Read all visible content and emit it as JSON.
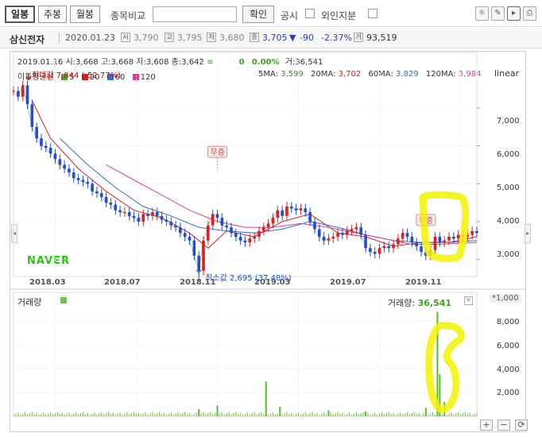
{
  "toolbar": {
    "tabs": [
      {
        "label": "일봉",
        "active": true
      },
      {
        "label": "주봉",
        "active": false
      },
      {
        "label": "월봉",
        "active": false
      }
    ],
    "compare_label": "종목비교",
    "compare_input_value": "",
    "confirm_label": "확인",
    "notice_label": "공시",
    "foreign_label": "외인지분",
    "tool_icons": [
      "lightbulb-icon",
      "pencil-icon",
      "cursor-icon",
      "print-icon"
    ]
  },
  "stock": {
    "name": "삼신전자",
    "date": "2020.01.23",
    "open_badge": "시",
    "open": "3,790",
    "high_badge": "고",
    "high": "3,795",
    "low_badge": "저",
    "low": "3,680",
    "close_badge": "종",
    "close": "3,705",
    "change_arrow": "▼",
    "change": "-90",
    "change_pct": "-2.37%",
    "volume_badge": "거",
    "volume": "93,519"
  },
  "cursor_info": {
    "date": "2019.01.16",
    "open_label": "시:",
    "open": "3,668",
    "high_label": "고:",
    "high": "3,668",
    "low_label": "저:",
    "low": "3,608",
    "close_label": "종:",
    "close": "3,642",
    "diff": "0",
    "diff_pct": "0.00%",
    "vol_label": "거:",
    "volume": "36,541"
  },
  "moving_average": {
    "title": "이동평균선",
    "periods": [
      {
        "label": "5",
        "color": "#5aa02c"
      },
      {
        "label": "20",
        "color": "#d62020"
      },
      {
        "label": "60",
        "color": "#2f6fd0"
      },
      {
        "label": "120",
        "color": "#e23c9a"
      }
    ],
    "values": [
      {
        "label": "5MA:",
        "value": "3,599",
        "color": "#3a8a1a"
      },
      {
        "label": "20MA:",
        "value": "3,702",
        "color": "#d62020"
      },
      {
        "label": "60MA:",
        "value": "3,829",
        "color": "#2f6fd0"
      },
      {
        "label": "120MA:",
        "value": "3,984",
        "color": "#e23c9a"
      }
    ]
  },
  "scale_mode": "linear",
  "chart_data": {
    "type": "line",
    "price_axis": {
      "ticks": [
        "7,000",
        "6,000",
        "5,000",
        "4,000",
        "3,000"
      ],
      "values": [
        7000,
        6000,
        5000,
        4000,
        3000
      ],
      "range": [
        2550,
        7650
      ]
    },
    "x_ticks": [
      "2018.03",
      "2018.07",
      "2018.11",
      "2019.03",
      "2019.07",
      "2019.11"
    ],
    "x_tick_pos": [
      0.09,
      0.265,
      0.44,
      0.615,
      0.79,
      0.965
    ],
    "price_series": [
      [
        0.0,
        7450
      ],
      [
        0.01,
        7300
      ],
      [
        0.02,
        7600
      ],
      [
        0.03,
        7100
      ],
      [
        0.04,
        6500
      ],
      [
        0.05,
        6200
      ],
      [
        0.06,
        6000
      ],
      [
        0.07,
        5950
      ],
      [
        0.08,
        5800
      ],
      [
        0.09,
        5650
      ],
      [
        0.1,
        5500
      ],
      [
        0.11,
        5400
      ],
      [
        0.12,
        5300
      ],
      [
        0.13,
        5150
      ],
      [
        0.14,
        5100
      ],
      [
        0.15,
        5050
      ],
      [
        0.16,
        5000
      ],
      [
        0.17,
        4800
      ],
      [
        0.18,
        4750
      ],
      [
        0.19,
        4650
      ],
      [
        0.2,
        4500
      ],
      [
        0.21,
        4450
      ],
      [
        0.22,
        4300
      ],
      [
        0.23,
        4250
      ],
      [
        0.24,
        4250
      ],
      [
        0.25,
        4150
      ],
      [
        0.26,
        4100
      ],
      [
        0.27,
        4000
      ],
      [
        0.28,
        4200
      ],
      [
        0.29,
        4150
      ],
      [
        0.3,
        4250
      ],
      [
        0.31,
        4150
      ],
      [
        0.32,
        4050
      ],
      [
        0.33,
        4000
      ],
      [
        0.34,
        3900
      ],
      [
        0.35,
        3850
      ],
      [
        0.36,
        3700
      ],
      [
        0.37,
        3600
      ],
      [
        0.38,
        3500
      ],
      [
        0.39,
        3100
      ],
      [
        0.4,
        2700
      ],
      [
        0.41,
        3500
      ],
      [
        0.42,
        3900
      ],
      [
        0.43,
        4200
      ],
      [
        0.44,
        4100
      ],
      [
        0.45,
        3900
      ],
      [
        0.46,
        3850
      ],
      [
        0.47,
        3700
      ],
      [
        0.48,
        3600
      ],
      [
        0.49,
        3500
      ],
      [
        0.5,
        3450
      ],
      [
        0.51,
        3550
      ],
      [
        0.52,
        3600
      ],
      [
        0.53,
        3750
      ],
      [
        0.54,
        3850
      ],
      [
        0.55,
        3950
      ],
      [
        0.56,
        4100
      ],
      [
        0.57,
        4300
      ],
      [
        0.58,
        4150
      ],
      [
        0.59,
        4400
      ],
      [
        0.6,
        4350
      ],
      [
        0.61,
        4300
      ],
      [
        0.62,
        4350
      ],
      [
        0.63,
        4250
      ],
      [
        0.64,
        4000
      ],
      [
        0.65,
        3800
      ],
      [
        0.66,
        3600
      ],
      [
        0.67,
        3500
      ],
      [
        0.68,
        3550
      ],
      [
        0.69,
        3600
      ],
      [
        0.7,
        3700
      ],
      [
        0.71,
        3650
      ],
      [
        0.72,
        3750
      ],
      [
        0.73,
        3800
      ],
      [
        0.74,
        3850
      ],
      [
        0.75,
        3650
      ],
      [
        0.76,
        3300
      ],
      [
        0.77,
        3200
      ],
      [
        0.78,
        3150
      ],
      [
        0.79,
        3300
      ],
      [
        0.8,
        3350
      ],
      [
        0.81,
        3300
      ],
      [
        0.82,
        3400
      ],
      [
        0.83,
        3550
      ],
      [
        0.84,
        3700
      ],
      [
        0.85,
        3600
      ],
      [
        0.86,
        3450
      ],
      [
        0.87,
        3350
      ],
      [
        0.88,
        3200
      ],
      [
        0.89,
        3100
      ],
      [
        0.9,
        3250
      ],
      [
        0.91,
        3600
      ],
      [
        0.92,
        3450
      ],
      [
        0.93,
        3500
      ],
      [
        0.94,
        3600
      ],
      [
        0.95,
        3550
      ],
      [
        0.96,
        3650
      ],
      [
        0.97,
        3600
      ],
      [
        0.98,
        3650
      ],
      [
        0.99,
        3750
      ],
      [
        1.0,
        3700
      ]
    ],
    "ma_series": [
      {
        "name": "20",
        "color": "#d62020",
        "values": [
          [
            0.04,
            7200
          ],
          [
            0.08,
            6200
          ],
          [
            0.14,
            5400
          ],
          [
            0.2,
            4800
          ],
          [
            0.26,
            4300
          ],
          [
            0.32,
            4100
          ],
          [
            0.38,
            3700
          ],
          [
            0.42,
            3300
          ],
          [
            0.46,
            3750
          ],
          [
            0.52,
            3600
          ],
          [
            0.58,
            4000
          ],
          [
            0.64,
            4200
          ],
          [
            0.7,
            3700
          ],
          [
            0.76,
            3600
          ],
          [
            0.82,
            3350
          ],
          [
            0.88,
            3450
          ],
          [
            0.94,
            3450
          ],
          [
            1.0,
            3600
          ]
        ]
      },
      {
        "name": "60",
        "color": "#2f6fd0",
        "values": [
          [
            0.1,
            6200
          ],
          [
            0.16,
            5500
          ],
          [
            0.22,
            4900
          ],
          [
            0.28,
            4400
          ],
          [
            0.34,
            4150
          ],
          [
            0.4,
            3850
          ],
          [
            0.46,
            3750
          ],
          [
            0.52,
            3700
          ],
          [
            0.58,
            3800
          ],
          [
            0.64,
            4000
          ],
          [
            0.7,
            3850
          ],
          [
            0.76,
            3650
          ],
          [
            0.82,
            3500
          ],
          [
            0.88,
            3450
          ],
          [
            0.94,
            3450
          ],
          [
            1.0,
            3500
          ]
        ]
      },
      {
        "name": "120",
        "color": "#e23c9a",
        "values": [
          [
            0.2,
            5500
          ],
          [
            0.26,
            5100
          ],
          [
            0.32,
            4700
          ],
          [
            0.38,
            4300
          ],
          [
            0.44,
            4000
          ],
          [
            0.5,
            3850
          ],
          [
            0.56,
            3850
          ],
          [
            0.62,
            3950
          ],
          [
            0.68,
            3850
          ],
          [
            0.74,
            3700
          ],
          [
            0.8,
            3550
          ],
          [
            0.86,
            3400
          ],
          [
            0.92,
            3400
          ],
          [
            1.0,
            3450
          ]
        ]
      }
    ],
    "max_marker": {
      "label": "최대값 7,844 (-52.77%)",
      "x": 0.005,
      "value": 7844
    },
    "min_marker": {
      "label": "최소값 2,695 (37.48%)",
      "x": 0.4,
      "value": 2695
    },
    "bonus_markers": [
      {
        "label": "무증",
        "x": 0.44,
        "value": 5800
      },
      {
        "label": "무증",
        "x": 0.89,
        "value": 4000
      }
    ],
    "volume_axis": {
      "ticks": [
        "8,000",
        "6,000",
        "4,000",
        "2,000"
      ],
      "values": [
        8000,
        6000,
        4000,
        2000
      ],
      "range": [
        0,
        9200
      ]
    },
    "volume_unit": "*1,000",
    "volume_label": "거래량",
    "volume_readout_label": "거래량:",
    "volume_readout_value": "36,541",
    "volume_spikes": [
      {
        "x": 0.4,
        "value": 600
      },
      {
        "x": 0.44,
        "value": 900
      },
      {
        "x": 0.545,
        "value": 2900
      },
      {
        "x": 0.575,
        "value": 800
      },
      {
        "x": 0.68,
        "value": 500
      },
      {
        "x": 0.76,
        "value": 400
      },
      {
        "x": 0.89,
        "value": 700
      },
      {
        "x": 0.915,
        "value": 8700
      },
      {
        "x": 0.92,
        "value": 3500
      },
      {
        "x": 0.93,
        "value": 1200
      }
    ]
  },
  "annotations": {
    "highlight_color": "#f2f200"
  },
  "watermark": "NAVER",
  "zoom": {
    "in": "+",
    "out": "−",
    "reset": "⟳"
  }
}
